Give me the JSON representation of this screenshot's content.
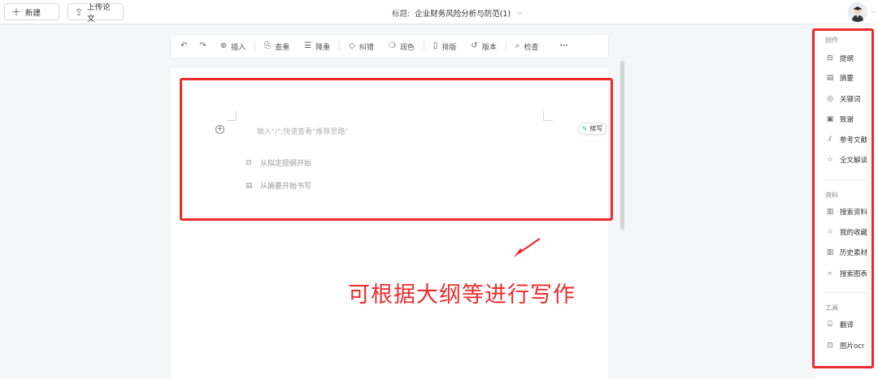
{
  "topbar": {
    "new_button": {
      "icon": "plus-icon",
      "label": "新建"
    },
    "upload_button": {
      "icon": "cloud-upload-icon",
      "label": "上传论文"
    },
    "title_label": "标题:",
    "title_value": "企业财务风险分析与防范(1)",
    "title_icon": "chevron-down-icon",
    "avatar_icon": "user-avatar-icon"
  },
  "toolbar": {
    "undo_icon": "undo-icon",
    "redo_icon": "redo-icon",
    "items": [
      {
        "icon": "plus-circle-icon",
        "label": "插入"
      },
      {
        "icon": "duplicate-check-icon",
        "label": "查重"
      },
      {
        "icon": "reduce-duplicate-icon",
        "label": "降重"
      },
      {
        "icon": "eraser-icon",
        "label": "纠错"
      },
      {
        "icon": "polish-icon",
        "label": "润色"
      },
      {
        "icon": "layout-icon",
        "label": "排版"
      },
      {
        "icon": "history-icon",
        "label": "版本"
      },
      {
        "icon": "inspect-icon",
        "label": "检查"
      }
    ],
    "more_label": "···"
  },
  "editor": {
    "placeholder": "输入\"/\",快速查看\"推荐思路\"",
    "continue_label": "续写",
    "start_outline": "从拟定提纲开始",
    "start_abstract": "从摘要开始书写"
  },
  "annotation": {
    "text": "可根据大纲等进行写作",
    "color": "#ee2b2b"
  },
  "right_panel": {
    "create_title": "创作",
    "create_items": [
      {
        "icon": "outline-icon",
        "label": "提纲"
      },
      {
        "icon": "abstract-icon",
        "label": "摘要"
      },
      {
        "icon": "keyword-icon",
        "label": "关键词"
      },
      {
        "icon": "thanks-icon",
        "label": "致谢"
      },
      {
        "icon": "reference-icon",
        "label": "参考文献"
      },
      {
        "icon": "star-icon",
        "label": "全文解读"
      }
    ],
    "material_title": "资料",
    "material_items": [
      {
        "icon": "search-material-icon",
        "label": "搜索资料"
      },
      {
        "icon": "star-outline-icon",
        "label": "我的收藏"
      },
      {
        "icon": "bar-chart-icon",
        "label": "历史素材"
      },
      {
        "icon": "search-chart-icon",
        "label": "搜索图表"
      }
    ],
    "tools_title": "工具",
    "tools_items": [
      {
        "icon": "translate-icon",
        "label": "翻译"
      },
      {
        "icon": "ocr-icon",
        "label": "图片ocr"
      }
    ]
  }
}
